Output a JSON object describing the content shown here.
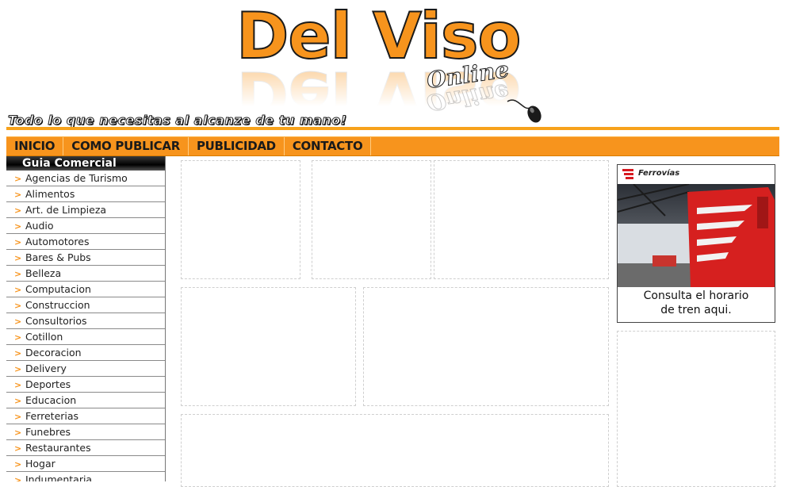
{
  "header": {
    "logo_text": "Del Viso",
    "logo_sub": "Online",
    "tagline": "Todo lo que necesitas al alcanze de tu mano!"
  },
  "nav": {
    "items": [
      "INICIO",
      "COMO PUBLICAR",
      "PUBLICIDAD",
      "CONTACTO"
    ]
  },
  "sidebar": {
    "title": "Guia Comercial",
    "items": [
      "Agencias de Turismo",
      "Alimentos",
      "Art. de Limpieza",
      "Audio",
      "Automotores",
      "Bares & Pubs",
      "Belleza",
      "Computacion",
      "Construccion",
      "Consultorios",
      "Cotillon",
      "Decoracion",
      "Delivery",
      "Deportes",
      "Educacion",
      "Ferreterias",
      "Funebres",
      "Restaurantes",
      "Hogar",
      "Indumentaria"
    ]
  },
  "ad": {
    "brand": "Ferrovías",
    "caption_line1": "Consulta el horario",
    "caption_line2": "de tren aqui."
  },
  "colors": {
    "accent": "#f7941d",
    "sidebar_header": "#000000"
  }
}
